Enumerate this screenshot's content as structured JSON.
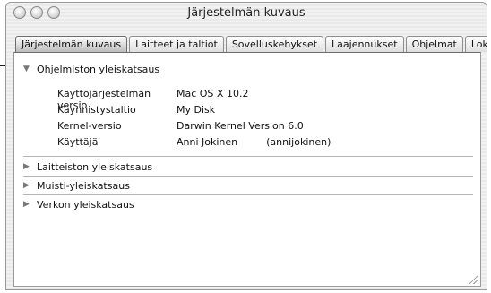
{
  "window": {
    "title": "Järjestelmän kuvaus"
  },
  "tabs": [
    {
      "label": "Järjestelmän kuvaus",
      "active": true
    },
    {
      "label": "Laitteet ja taltiot",
      "active": false
    },
    {
      "label": "Sovelluskehykset",
      "active": false
    },
    {
      "label": "Laajennukset",
      "active": false
    },
    {
      "label": "Ohjelmat",
      "active": false
    },
    {
      "label": "Lokit",
      "active": false
    }
  ],
  "sections": [
    {
      "label": "Ohjelmiston yleiskatsaus",
      "expanded": true,
      "rows": [
        {
          "label": "Käyttöjärjestelmän versio",
          "value": "Mac OS X 10.2"
        },
        {
          "label": "Käynnistystaltio",
          "value": "My Disk"
        },
        {
          "label": "Kernel-versio",
          "value": "Darwin Kernel Version 6.0"
        },
        {
          "label": "Käyttäjä",
          "value": "Anni Jokinen",
          "extra": "(annijokinen)"
        }
      ]
    },
    {
      "label": "Laitteiston yleiskatsaus",
      "expanded": false
    },
    {
      "label": "Muisti-yleiskatsaus",
      "expanded": false
    },
    {
      "label": "Verkon yleiskatsaus",
      "expanded": false
    }
  ],
  "icons": {
    "expanded": "disclosure-triangle-down-icon",
    "collapsed": "disclosure-triangle-right-icon"
  }
}
